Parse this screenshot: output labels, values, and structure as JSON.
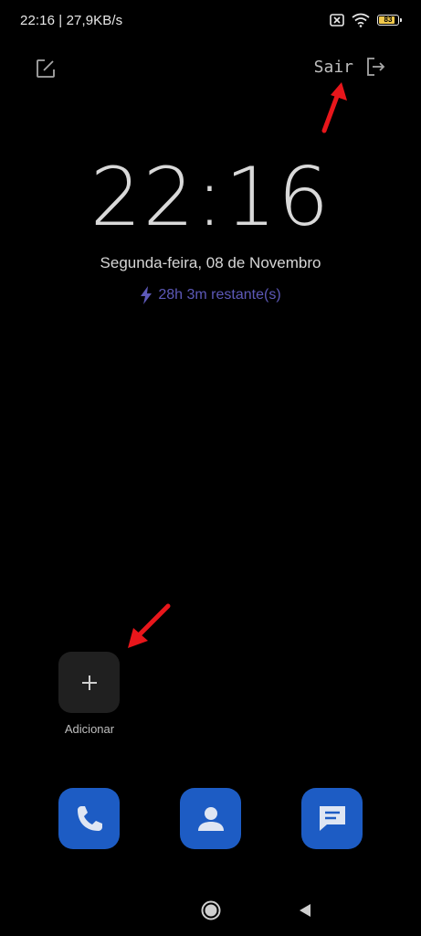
{
  "status_bar": {
    "time_speed": "22:16 | 27,9KB/s",
    "battery_level": "83",
    "icons": [
      "sim-x-icon",
      "wifi-icon",
      "battery-icon"
    ]
  },
  "header": {
    "edit_icon": "edit-icon",
    "exit_label": "Sair",
    "exit_icon": "logout-icon"
  },
  "clock": {
    "time": "22:16",
    "date": "Segunda-feira, 08 de Novembro",
    "charge_text": "28h 3m restante(s)",
    "charge_icon": "lightning-icon"
  },
  "shortcuts": {
    "add_label": "Adicionar",
    "add_icon": "plus-icon"
  },
  "dock": {
    "apps": [
      "phone-app",
      "contacts-app",
      "messages-app"
    ]
  },
  "nav": {
    "home_icon": "home-circle-icon",
    "back_icon": "back-triangle-icon"
  },
  "colors": {
    "background": "#000000",
    "charge_accent": "#5d59b8",
    "dock_blue": "#1d5cc4",
    "annotation_red": "#e8161b"
  }
}
